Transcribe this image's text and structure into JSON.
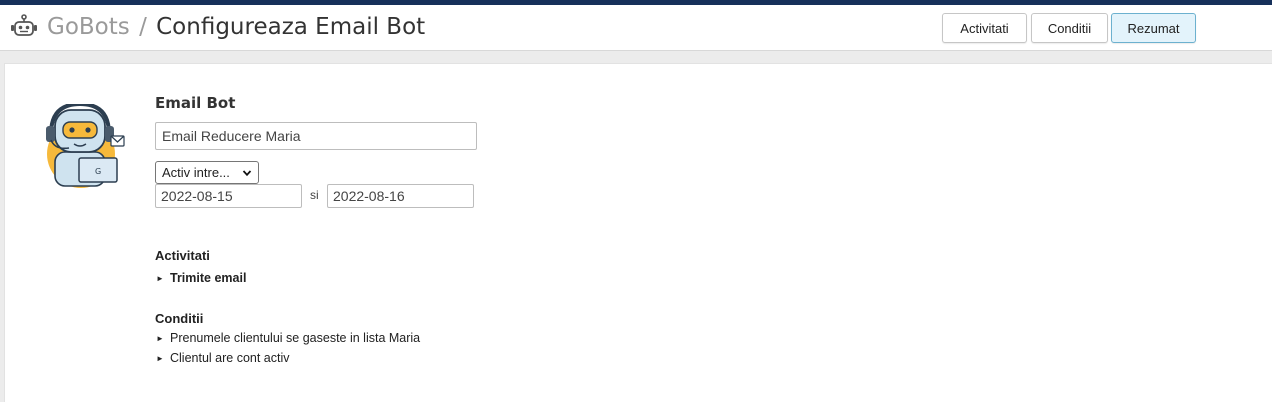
{
  "header": {
    "root": "GoBots",
    "separator": "/",
    "page_title": "Configureaza Email Bot",
    "buttons": [
      "Activitati",
      "Conditii",
      "Rezumat"
    ],
    "active_button": "Rezumat"
  },
  "bot": {
    "title": "Email Bot",
    "name_value": "Email Reducere Maria",
    "schedule_select": "Activ intre...",
    "date_from": "2022-08-15",
    "date_join": "si",
    "date_to": "2022-08-16"
  },
  "activities": {
    "title": "Activitati",
    "items": [
      "Trimite email"
    ]
  },
  "conditions": {
    "title": "Conditii",
    "items": [
      "Prenumele clientului se gaseste in lista Maria",
      "Clientul are cont activ"
    ]
  },
  "icons": [
    "robot-icon",
    "bot-illustration",
    "chevron-down-icon",
    "bullet-triangle-icon"
  ],
  "colors": {
    "top_bar": "#16305a",
    "active_button_bg": "#e3f3fb",
    "active_button_border": "#6cb1cf"
  }
}
